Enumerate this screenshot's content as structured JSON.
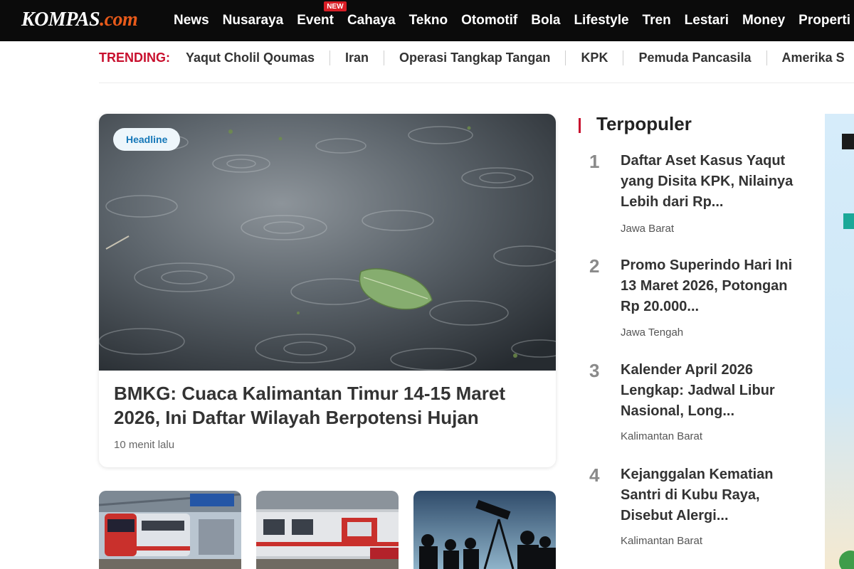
{
  "site": {
    "logo_main": "KOMPAS",
    "logo_suffix": ".com"
  },
  "nav": {
    "items": [
      "News",
      "Nusaraya",
      "Event",
      "Cahaya",
      "Tekno",
      "Otomotif",
      "Bola",
      "Lifestyle",
      "Tren",
      "Lestari",
      "Money",
      "Properti"
    ],
    "new_badge": "NEW"
  },
  "trending": {
    "label": "TRENDING:",
    "items": [
      "Yaqut Cholil Qoumas",
      "Iran",
      "Operasi Tangkap Tangan",
      "KPK",
      "Pemuda Pancasila",
      "Amerika S"
    ]
  },
  "headline": {
    "tag": "Headline",
    "title": "BMKG: Cuaca Kalimantan Timur 14-15 Maret 2026, Ini Daftar Wilayah Berpotensi Hujan",
    "time": "10 menit lalu"
  },
  "popular": {
    "title": "Terpopuler",
    "items": [
      {
        "num": "1",
        "title": "Daftar Aset Kasus Yaqut yang Disita KPK, Nilainya Lebih dari Rp...",
        "location": "Jawa Barat"
      },
      {
        "num": "2",
        "title": "Promo Superindo Hari Ini 13 Maret 2026, Potongan Rp 20.000...",
        "location": "Jawa Tengah"
      },
      {
        "num": "3",
        "title": "Kalender April 2026 Lengkap: Jadwal Libur Nasional, Long...",
        "location": "Kalimantan Barat"
      },
      {
        "num": "4",
        "title": "Kejanggalan Kematian Santri di Kubu Raya, Disebut Alergi...",
        "location": "Kalimantan Barat"
      }
    ]
  },
  "colors": {
    "brand_red": "#c8102e",
    "topbar": "#0b0b0b",
    "tag_blue": "#1577b8"
  }
}
